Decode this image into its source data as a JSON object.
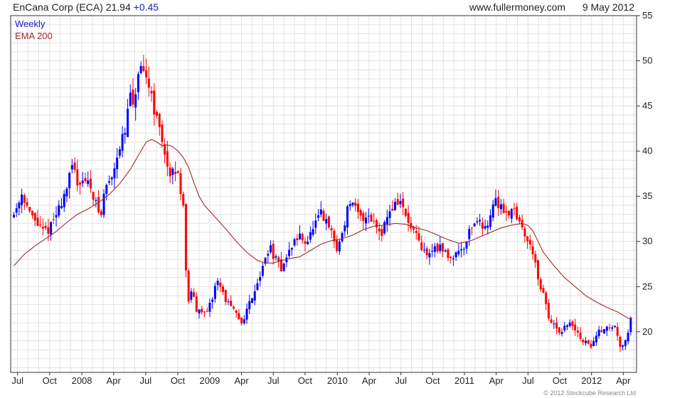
{
  "header": {
    "title": "EnCana Corp (ECA)",
    "price": "21.94",
    "change": "+0.45",
    "source": "www.fullermoney.com",
    "date": "9 May 2012"
  },
  "legend": {
    "weekly_label": "Weekly",
    "ema_label": "EMA 200",
    "weekly_color": "#1a1acc",
    "ema_color": "#a52a2a"
  },
  "copyright": "© 2012 Stockcube Research Ltd",
  "colors": {
    "up": "#0000ff",
    "down": "#ff0000",
    "ema": "#a52a2a",
    "grid": "#e2e2e2",
    "axis": "#333333"
  },
  "chart_data": {
    "type": "candlestick",
    "frequency": "weekly",
    "grid": true,
    "legend_position": "top-left",
    "y_axis_side": "right",
    "ylim": [
      15.5,
      55
    ],
    "y_ticks": [
      20,
      25,
      30,
      35,
      40,
      45,
      50,
      55
    ],
    "x_ticks": [
      {
        "label": "Jul",
        "t": 0.35
      },
      {
        "label": "Oct",
        "t": 3.38
      },
      {
        "label": "2008",
        "t": 6.42
      },
      {
        "label": "Apr",
        "t": 9.42
      },
      {
        "label": "Jul",
        "t": 12.45
      },
      {
        "label": "Oct",
        "t": 15.48
      },
      {
        "label": "2009",
        "t": 18.5
      },
      {
        "label": "Apr",
        "t": 21.5
      },
      {
        "label": "Jul",
        "t": 24.5
      },
      {
        "label": "Oct",
        "t": 27.5
      },
      {
        "label": "2010",
        "t": 30.55
      },
      {
        "label": "Apr",
        "t": 33.55
      },
      {
        "label": "Jul",
        "t": 36.55
      },
      {
        "label": "Oct",
        "t": 39.55
      },
      {
        "label": "2011",
        "t": 42.55
      },
      {
        "label": "Apr",
        "t": 45.55
      },
      {
        "label": "Jul",
        "t": 48.55
      },
      {
        "label": "Oct",
        "t": 51.55
      },
      {
        "label": "2012",
        "t": 54.55
      },
      {
        "label": "Apr",
        "t": 57.55
      }
    ],
    "xlim": [
      -0.3,
      58.8
    ],
    "price_path": [
      [
        0,
        33
      ],
      [
        0.8,
        35.5
      ],
      [
        1.5,
        33
      ],
      [
        2.2,
        32
      ],
      [
        2.8,
        31
      ],
      [
        3.4,
        31.5
      ],
      [
        4.2,
        33.5
      ],
      [
        5,
        36
      ],
      [
        5.6,
        38.5
      ],
      [
        6,
        36.5
      ],
      [
        6.5,
        37
      ],
      [
        7.3,
        36
      ],
      [
        7.8,
        34
      ],
      [
        8.2,
        32.5
      ],
      [
        8.6,
        36
      ],
      [
        9.2,
        37
      ],
      [
        9.8,
        40
      ],
      [
        10.5,
        42
      ],
      [
        11,
        46.5
      ],
      [
        11.2,
        44
      ],
      [
        11.8,
        49
      ],
      [
        12.3,
        48
      ],
      [
        12.8,
        47.5
      ],
      [
        13.3,
        44.5
      ],
      [
        13.8,
        42
      ],
      [
        14.3,
        40
      ],
      [
        14.7,
        36.5
      ],
      [
        15.1,
        38
      ],
      [
        15.6,
        37
      ],
      [
        16,
        34
      ],
      [
        16.2,
        28
      ],
      [
        16.5,
        23
      ],
      [
        16.8,
        25
      ],
      [
        17.2,
        22
      ],
      [
        17.6,
        23
      ],
      [
        18.1,
        21.5
      ],
      [
        18.7,
        23.5
      ],
      [
        19.2,
        26
      ],
      [
        19.8,
        24
      ],
      [
        20.3,
        23
      ],
      [
        20.9,
        22
      ],
      [
        21.5,
        21
      ],
      [
        22.2,
        23
      ],
      [
        22.8,
        25
      ],
      [
        23.5,
        27
      ],
      [
        24.1,
        29.5
      ],
      [
        24.7,
        28
      ],
      [
        25.2,
        27
      ],
      [
        25.9,
        28.5
      ],
      [
        26.4,
        30
      ],
      [
        27,
        30.5
      ],
      [
        27.7,
        30
      ],
      [
        28.3,
        31.5
      ],
      [
        29,
        33
      ],
      [
        29.5,
        32
      ],
      [
        30,
        31
      ],
      [
        30.5,
        29
      ],
      [
        31,
        31
      ],
      [
        31.7,
        34.5
      ],
      [
        32.2,
        33.5
      ],
      [
        32.8,
        32.5
      ],
      [
        33.5,
        33
      ],
      [
        34.1,
        32
      ],
      [
        34.7,
        31
      ],
      [
        35.3,
        33
      ],
      [
        35.9,
        34
      ],
      [
        36.5,
        34.5
      ],
      [
        37.2,
        32
      ],
      [
        37.8,
        31
      ],
      [
        38.5,
        29
      ],
      [
        39.2,
        28.5
      ],
      [
        39.8,
        29.5
      ],
      [
        40.5,
        29
      ],
      [
        41.2,
        28.2
      ],
      [
        41.8,
        28.8
      ],
      [
        42.5,
        29.5
      ],
      [
        43.1,
        31.5
      ],
      [
        43.7,
        32.5
      ],
      [
        44.3,
        31.5
      ],
      [
        44.9,
        32.5
      ],
      [
        45.4,
        34.5
      ],
      [
        46,
        34
      ],
      [
        46.6,
        33
      ],
      [
        47.2,
        34
      ],
      [
        47.7,
        32
      ],
      [
        48.2,
        31
      ],
      [
        48.7,
        29.5
      ],
      [
        49.2,
        28.5
      ],
      [
        49.6,
        24.5
      ],
      [
        50.1,
        24
      ],
      [
        50.6,
        21
      ],
      [
        51.1,
        20.5
      ],
      [
        51.7,
        19.5
      ],
      [
        52.2,
        21
      ],
      [
        52.8,
        20.5
      ],
      [
        53.4,
        19.5
      ],
      [
        53.9,
        18.8
      ],
      [
        54.5,
        18.5
      ],
      [
        55,
        19.5
      ],
      [
        55.6,
        20.5
      ],
      [
        56.2,
        20.3
      ],
      [
        56.7,
        20.8
      ],
      [
        57.2,
        18.5
      ],
      [
        57.7,
        19
      ],
      [
        58.1,
        20.5
      ],
      [
        58.4,
        21.94
      ]
    ],
    "ema_path": [
      [
        0,
        27.3
      ],
      [
        1,
        28.6
      ],
      [
        2,
        29.5
      ],
      [
        3,
        30.3
      ],
      [
        4,
        31.1
      ],
      [
        5,
        32.1
      ],
      [
        6,
        33.0
      ],
      [
        7,
        33.6
      ],
      [
        8,
        34.3
      ],
      [
        9,
        35.2
      ],
      [
        10,
        36.4
      ],
      [
        11,
        38.0
      ],
      [
        12,
        40.0
      ],
      [
        12.5,
        41.0
      ],
      [
        13,
        41.3
      ],
      [
        13.5,
        41.0
      ],
      [
        14,
        40.6
      ],
      [
        14.5,
        40.7
      ],
      [
        15,
        40.5
      ],
      [
        15.5,
        40.0
      ],
      [
        16,
        39.3
      ],
      [
        16.5,
        38.2
      ],
      [
        17,
        36.5
      ],
      [
        17.5,
        35.0
      ],
      [
        18,
        34.0
      ],
      [
        19,
        32.7
      ],
      [
        20,
        31.4
      ],
      [
        21,
        30.0
      ],
      [
        22,
        28.8
      ],
      [
        23,
        27.9
      ],
      [
        23.5,
        27.7
      ],
      [
        24,
        27.6
      ],
      [
        24.5,
        27.6
      ],
      [
        25,
        27.8
      ],
      [
        26,
        28.1
      ],
      [
        27,
        28.3
      ],
      [
        28,
        29.0
      ],
      [
        29,
        29.7
      ],
      [
        30,
        30.1
      ],
      [
        31,
        30.3
      ],
      [
        32,
        30.7
      ],
      [
        33,
        31.3
      ],
      [
        34,
        31.7
      ],
      [
        35,
        31.8
      ],
      [
        36,
        32.0
      ],
      [
        37,
        31.9
      ],
      [
        38,
        31.5
      ],
      [
        39,
        31.2
      ],
      [
        40,
        30.7
      ],
      [
        41,
        30.2
      ],
      [
        42,
        29.8
      ],
      [
        43,
        30.0
      ],
      [
        44,
        30.5
      ],
      [
        45,
        31.0
      ],
      [
        46,
        31.5
      ],
      [
        47,
        31.8
      ],
      [
        48,
        32.0
      ],
      [
        48.5,
        31.8
      ],
      [
        49,
        31.2
      ],
      [
        49.5,
        30.0
      ],
      [
        50,
        28.8
      ],
      [
        51,
        27.3
      ],
      [
        52,
        26.0
      ],
      [
        53,
        25.0
      ],
      [
        54,
        24.0
      ],
      [
        55,
        23.3
      ],
      [
        56,
        22.7
      ],
      [
        57,
        22.2
      ],
      [
        58,
        21.5
      ],
      [
        58.4,
        21.5
      ]
    ]
  }
}
